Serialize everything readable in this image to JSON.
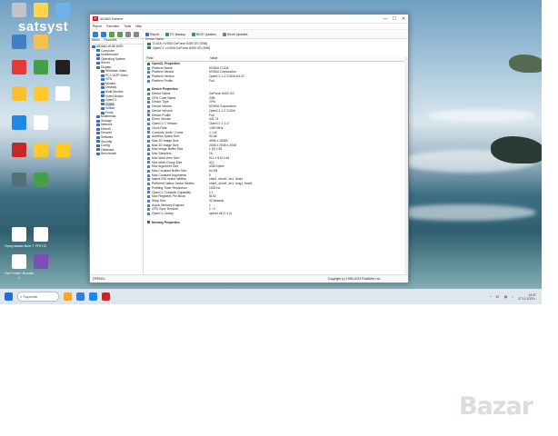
{
  "watermark": "satsyst",
  "desktop_icons": [
    {
      "label": "",
      "color": "#c0c4c8"
    },
    {
      "label": "",
      "color": "#ffd54f"
    },
    {
      "label": "",
      "color": "#6bb3e8"
    },
    {
      "label": "",
      "color": "#3f7fc2"
    },
    {
      "label": "",
      "color": "#f2c14e"
    },
    {
      "label": "",
      "color": "#e53935"
    },
    {
      "label": "",
      "color": "#43a047"
    },
    {
      "label": "",
      "color": "#212121"
    },
    {
      "label": "",
      "color": "#fbc02d"
    },
    {
      "label": "",
      "color": "#ffca28"
    },
    {
      "label": "",
      "color": "#ffffff"
    },
    {
      "label": "",
      "color": "#1e88e5"
    },
    {
      "label": "",
      "color": "#ffffff"
    },
    {
      "label": "",
      "color": "#c62828"
    },
    {
      "label": "",
      "color": "#ffca28"
    },
    {
      "label": "",
      "color": "#ffca28"
    },
    {
      "label": "",
      "color": "#546e7a"
    },
    {
      "label": "",
      "color": "#43a047"
    },
    {
      "label": "Программи Вин 7",
      "color": "#ffffff"
    },
    {
      "label": "FRITZ!",
      "color": "#ffffff"
    },
    {
      "label": "Hot Folder Bundle 1",
      "color": "#ffffff"
    },
    {
      "label": "",
      "color": "#7b4fb5"
    }
  ],
  "window": {
    "title": "AIDA64 Extreme",
    "min": "—",
    "max": "☐",
    "close": "✕",
    "menu": [
      "Report",
      "Favorites",
      "Tools",
      "Help"
    ],
    "toolbar": [
      "Report",
      "PC Backup",
      "BIOS Updates",
      "Driver Updates"
    ]
  },
  "left_panel": {
    "tabs": [
      "Menu",
      "Favorites"
    ],
    "tree": [
      {
        "label": "AIDA64 v6.88.6400",
        "indent": 0
      },
      {
        "label": "Computer",
        "indent": 1
      },
      {
        "label": "Motherboard",
        "indent": 1
      },
      {
        "label": "Operating System",
        "indent": 1
      },
      {
        "label": "Server",
        "indent": 1
      },
      {
        "label": "Display",
        "indent": 1
      },
      {
        "label": "Windows Video",
        "indent": 2
      },
      {
        "label": "PCI / AGP Video",
        "indent": 2
      },
      {
        "label": "GPU",
        "indent": 2
      },
      {
        "label": "Monitor",
        "indent": 2
      },
      {
        "label": "Desktop",
        "indent": 2
      },
      {
        "label": "Multi-Monitor",
        "indent": 2
      },
      {
        "label": "Video Modes",
        "indent": 2
      },
      {
        "label": "OpenCL",
        "indent": 2
      },
      {
        "label": "CUDA",
        "indent": 2,
        "selected": true
      },
      {
        "label": "Vulkan",
        "indent": 2
      },
      {
        "label": "Fonts",
        "indent": 2
      },
      {
        "label": "Multimedia",
        "indent": 1
      },
      {
        "label": "Storage",
        "indent": 1
      },
      {
        "label": "Network",
        "indent": 1
      },
      {
        "label": "DirectX",
        "indent": 1
      },
      {
        "label": "Devices",
        "indent": 1
      },
      {
        "label": "Software",
        "indent": 1
      },
      {
        "label": "Security",
        "indent": 1
      },
      {
        "label": "Config",
        "indent": 1
      },
      {
        "label": "Database",
        "indent": 1
      },
      {
        "label": "Benchmark",
        "indent": 1
      }
    ]
  },
  "right_panel": {
    "device_header": "Device Name",
    "devices": [
      "CUDA: nVIDIA GeForce 8400 GS (G98)",
      "OpenCL: nVIDIA GeForce 8400 GS (G98)"
    ],
    "col_field": "Field",
    "col_value": "Value",
    "rows": [
      {
        "field": "OpenCL Properties",
        "value": "",
        "section": true
      },
      {
        "field": "Platform Name",
        "value": "NVIDIA CUDA"
      },
      {
        "field": "Platform Vendor",
        "value": "NVIDIA Corporation"
      },
      {
        "field": "Platform Version",
        "value": "OpenCL 1.1 CUDA 6.5.21"
      },
      {
        "field": "Platform Profile",
        "value": "Full"
      },
      {
        "field": "",
        "value": ""
      },
      {
        "field": "Device Properties",
        "value": "",
        "section": true
      },
      {
        "field": "Device Name",
        "value": "GeForce 8400 GS"
      },
      {
        "field": "GPU Code Name",
        "value": "G98"
      },
      {
        "field": "Device Type",
        "value": "GPU"
      },
      {
        "field": "Device Vendor",
        "value": "NVIDIA Corporation"
      },
      {
        "field": "Device Version",
        "value": "OpenCL 1.0 CUDA"
      },
      {
        "field": "Device Profile",
        "value": "Full"
      },
      {
        "field": "Driver Version",
        "value": "341.74"
      },
      {
        "field": "OpenCL C Version",
        "value": "OpenCL C 1.0"
      },
      {
        "field": "Clock Rate",
        "value": "1400 MHz"
      },
      {
        "field": "Compute Units / Cores",
        "value": "1 / 16"
      },
      {
        "field": "Address Space Size",
        "value": "32-bit"
      },
      {
        "field": "Max 2D Image Size",
        "value": "4096 x 16383"
      },
      {
        "field": "Max 3D Image Size",
        "value": "2048 x 2048 x 2048"
      },
      {
        "field": "Max Image Buffer Size",
        "value": "1 (0) x 65"
      },
      {
        "field": "Max Samplers",
        "value": "16"
      },
      {
        "field": "Max Work-Item Size",
        "value": "512 x 512 x 64"
      },
      {
        "field": "Max Work-Group Size",
        "value": "512"
      },
      {
        "field": "Max Argument Size",
        "value": "4352 bytes"
      },
      {
        "field": "Max Constant Buffer Size",
        "value": "64 KB"
      },
      {
        "field": "Max Constant Arguments",
        "value": "9"
      },
      {
        "field": "Native ISA Vector Widths",
        "value": "char1, short1, int1, float1"
      },
      {
        "field": "Preferred Native Vector Widths",
        "value": "char1, short1, int1, long1, float1"
      },
      {
        "field": "Profiling Timer Resolution",
        "value": "1000 ns"
      },
      {
        "field": "OpenCL Compute Capability",
        "value": "1.1"
      },
      {
        "field": "Max Registers Per Block",
        "value": "8192"
      },
      {
        "field": "Warp Size",
        "value": "32 threads"
      },
      {
        "field": "Async Memory Engines",
        "value": "1"
      },
      {
        "field": "GPU Sync Devices",
        "value": "1 / 0"
      },
      {
        "field": "OpenCL Library",
        "value": "opencl.dll (1.1.0)"
      },
      {
        "field": "",
        "value": ""
      },
      {
        "field": "Memory Properties",
        "value": "",
        "section": true
      }
    ]
  },
  "status": {
    "left": "OPENCL",
    "center": "Copyright (c) 1995-2023 FinalWire Ltd."
  },
  "taskbar": {
    "search_placeholder": "Търсене",
    "tray_lang": "БГ",
    "time": "14:37",
    "date": "27.11.2023 г."
  },
  "logo": "Bazar"
}
